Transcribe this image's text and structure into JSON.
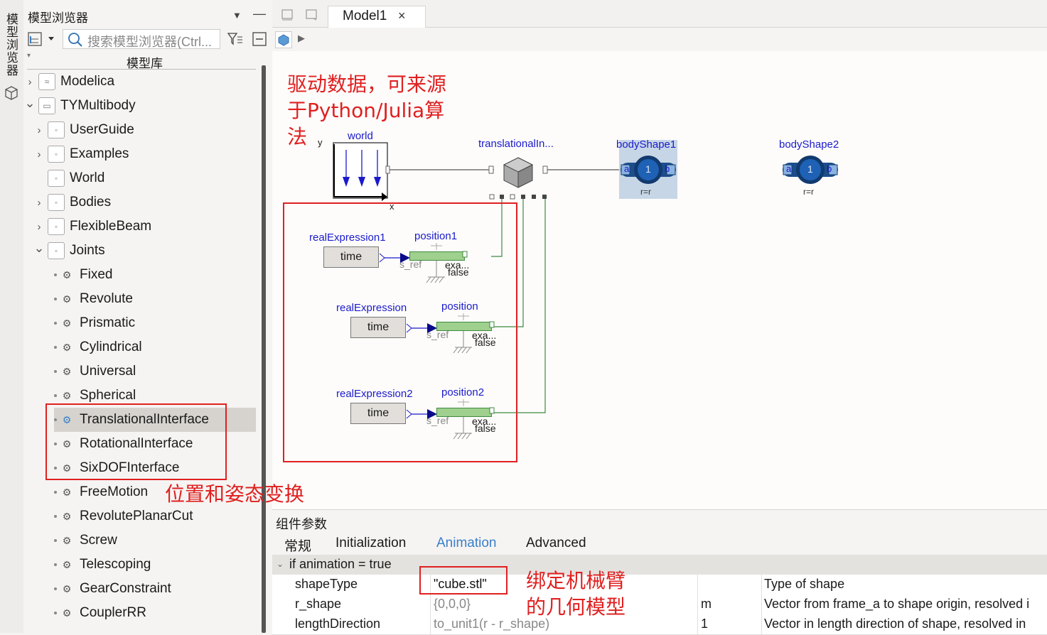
{
  "side_tab": {
    "label": "模型浏览器"
  },
  "browser": {
    "title": "模型浏览器",
    "search_placeholder": "搜索模型浏览器(Ctrl...",
    "library_header": "模型库",
    "items": [
      {
        "label": "Modelica",
        "expanded": false,
        "level": 0
      },
      {
        "label": "TYMultibody",
        "expanded": true,
        "level": 0
      },
      {
        "label": "UserGuide",
        "expanded": false,
        "level": 1
      },
      {
        "label": "Examples",
        "expanded": false,
        "level": 1
      },
      {
        "label": "World",
        "level": 1
      },
      {
        "label": "Bodies",
        "expanded": false,
        "level": 1
      },
      {
        "label": "FlexibleBeam",
        "expanded": false,
        "level": 1
      },
      {
        "label": "Joints",
        "expanded": true,
        "level": 1
      },
      {
        "label": "Fixed",
        "level": 2
      },
      {
        "label": "Revolute",
        "level": 2
      },
      {
        "label": "Prismatic",
        "level": 2
      },
      {
        "label": "Cylindrical",
        "level": 2
      },
      {
        "label": "Universal",
        "level": 2
      },
      {
        "label": "Spherical",
        "level": 2
      },
      {
        "label": "TranslationalInterface",
        "level": 2,
        "selected": true
      },
      {
        "label": "RotationalInterface",
        "level": 2
      },
      {
        "label": "SixDOFInterface",
        "level": 2
      },
      {
        "label": "FreeMotion",
        "level": 2
      },
      {
        "label": "RevolutePlanarCut",
        "level": 2
      },
      {
        "label": "Screw",
        "level": 2
      },
      {
        "label": "Telescoping",
        "level": 2
      },
      {
        "label": "GearConstraint",
        "level": 2
      },
      {
        "label": "CouplerRR",
        "level": 2
      }
    ]
  },
  "editor": {
    "tab_label": "Model1",
    "tab_close": "×"
  },
  "diagram": {
    "world": {
      "name": "world",
      "axis_y": "y",
      "axis_x": "x"
    },
    "translational": {
      "name": "translationalIn..."
    },
    "body1": {
      "name": "bodyShape1",
      "inner": "1",
      "port_a": "a",
      "port_b": "b",
      "param": "r=r"
    },
    "body2": {
      "name": "bodyShape2",
      "inner": "1",
      "port_a": "a",
      "port_b": "b",
      "param": "r=r"
    },
    "rows": [
      {
        "expr_name": "realExpression1",
        "expr_value": "time",
        "pos_name": "position1",
        "sref": "s_ref",
        "exa": "exa...",
        "false_lbl": "false"
      },
      {
        "expr_name": "realExpression",
        "expr_value": "time",
        "pos_name": "position",
        "sref": "s_ref",
        "exa": "exa...",
        "false_lbl": "false"
      },
      {
        "expr_name": "realExpression2",
        "expr_value": "time",
        "pos_name": "position2",
        "sref": "s_ref",
        "exa": "exa...",
        "false_lbl": "false"
      }
    ]
  },
  "annotations": {
    "drive": "驱动数据，可来源于Python/Julia算法",
    "drive_lines": [
      "驱动数据，可来源",
      "于Python/Julia算",
      "法"
    ],
    "pose": "位置和姿态变换",
    "bind_lines": [
      "绑定机械臂",
      "的几何模型"
    ]
  },
  "params": {
    "title": "组件参数",
    "tabs": [
      "常规",
      "Initialization",
      "Animation",
      "Advanced"
    ],
    "active_tab": "Animation",
    "group": "if animation = true",
    "rows": [
      {
        "name": "shapeType",
        "value": "\"cube.stl\"",
        "unit": "",
        "desc": "Type of shape"
      },
      {
        "name": "r_shape",
        "value": "{0,0,0}",
        "unit": "m",
        "desc": "Vector from frame_a to shape origin, resolved i"
      },
      {
        "name": "lengthDirection",
        "value": "to_unit1(r - r_shape)",
        "unit": "1",
        "desc": "Vector in length direction of shape, resolved in"
      }
    ]
  },
  "colors": {
    "annotation_red": "#e02020",
    "label_blue": "#1a1acc",
    "active_tab_blue": "#3a7fc8",
    "selected_row": "#d6d3cf",
    "position_green": "#9fd08e"
  }
}
